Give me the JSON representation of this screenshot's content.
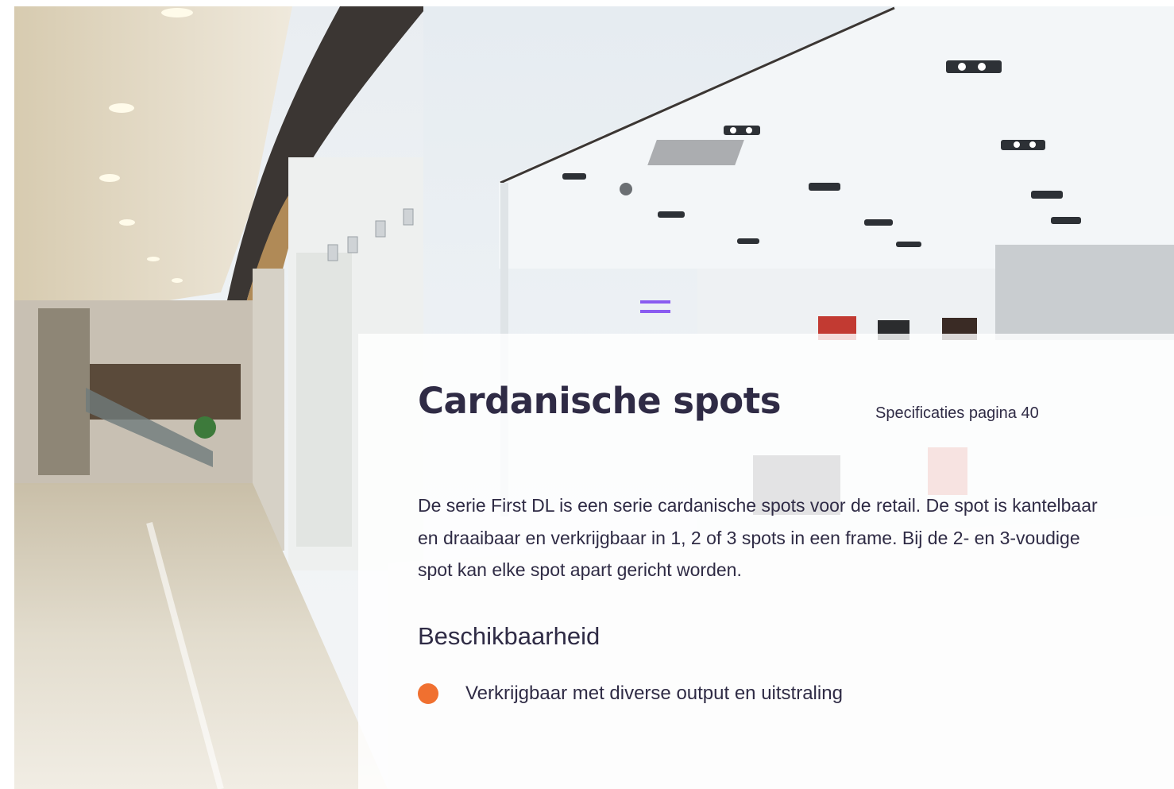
{
  "hero_image": {
    "subject": "shopping-mall-storefront-photo",
    "accent_color": "#8a5cf0"
  },
  "section": {
    "title": "Cardanische spots",
    "spec_reference": "Specificaties pagina 40",
    "intro": "De serie First DL is een serie cardanische spots voor de retail. De spot is kantelbaar en draaibaar en verkrijgbaar in 1, 2 of 3 spots in een frame. Bij de 2- en 3-voudige spot kan elke spot apart gericht worden.",
    "availability_heading": "Beschikbaarheid",
    "availability_items": [
      {
        "text": "Verkrijgbaar met diverse output en uitstraling",
        "bullet_color": "#f07030"
      }
    ]
  },
  "colors": {
    "text": "#2f2b45",
    "accent_orange": "#f07030",
    "panel_background": "#ffffff"
  }
}
